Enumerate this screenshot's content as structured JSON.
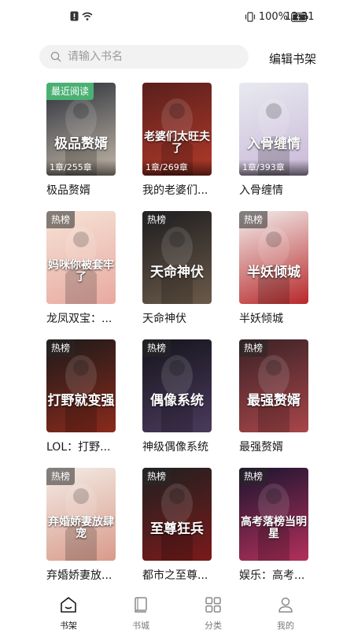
{
  "status": {
    "battery": "100%",
    "time": "13:31"
  },
  "search": {
    "placeholder": "请输入书名",
    "edit_label": "编辑书架"
  },
  "books": [
    {
      "title": "极品赘婿",
      "tag": "最近阅读",
      "progress": "1章/255章",
      "cover_text": "极品赘婿",
      "colors": [
        "#2a2f3a",
        "#c4b8a8"
      ]
    },
    {
      "title": "我的老婆们...",
      "tag": "",
      "progress": "1章/269章",
      "cover_text": "老婆们太旺夫了",
      "colors": [
        "#5a1f1c",
        "#b23a2a"
      ]
    },
    {
      "title": "入骨缠情",
      "tag": "",
      "progress": "1章/393章",
      "cover_text": "入骨缠情",
      "colors": [
        "#e8eaf0",
        "#c9b8d8"
      ]
    },
    {
      "title": "龙凤双宝：...",
      "tag": "热榜",
      "progress": "",
      "cover_text": "妈咪你被套牢了",
      "colors": [
        "#f6e3d6",
        "#e8a9a0"
      ]
    },
    {
      "title": "天命神伏",
      "tag": "热榜",
      "progress": "",
      "cover_text": "天命神伏",
      "colors": [
        "#1d1d1f",
        "#6b5a4a"
      ]
    },
    {
      "title": "半妖倾城",
      "tag": "热榜",
      "progress": "",
      "cover_text": "半妖倾城",
      "colors": [
        "#f2f0ee",
        "#b8282a"
      ]
    },
    {
      "title": "LOL：打野...",
      "tag": "热榜",
      "progress": "",
      "cover_text": "打野就变强",
      "colors": [
        "#1c1a1a",
        "#8a2a1c"
      ]
    },
    {
      "title": "神级偶像系统",
      "tag": "热榜",
      "progress": "",
      "cover_text": "偶像系统",
      "colors": [
        "#15151c",
        "#4a3a5c"
      ]
    },
    {
      "title": "最强赘婿",
      "tag": "热榜",
      "progress": "",
      "cover_text": "最强赘婿",
      "colors": [
        "#3a2226",
        "#a8464a"
      ]
    },
    {
      "title": "弃婚娇妻放...",
      "tag": "热榜",
      "progress": "",
      "cover_text": "弃婚娇妻放肆宠",
      "colors": [
        "#f3ece6",
        "#d99a8a"
      ]
    },
    {
      "title": "都市之至尊...",
      "tag": "热榜",
      "progress": "",
      "cover_text": "至尊狂兵",
      "colors": [
        "#202020",
        "#7a1a1a"
      ]
    },
    {
      "title": "娱乐：高考...",
      "tag": "热榜",
      "progress": "",
      "cover_text": "高考落榜当明星",
      "colors": [
        "#1b1530",
        "#b2305a"
      ]
    }
  ],
  "nav": [
    {
      "label": "书架",
      "icon": "bookshelf-icon",
      "active": true
    },
    {
      "label": "书城",
      "icon": "book-icon",
      "active": false
    },
    {
      "label": "分类",
      "icon": "grid-icon",
      "active": false
    },
    {
      "label": "我的",
      "icon": "person-icon",
      "active": false
    }
  ]
}
